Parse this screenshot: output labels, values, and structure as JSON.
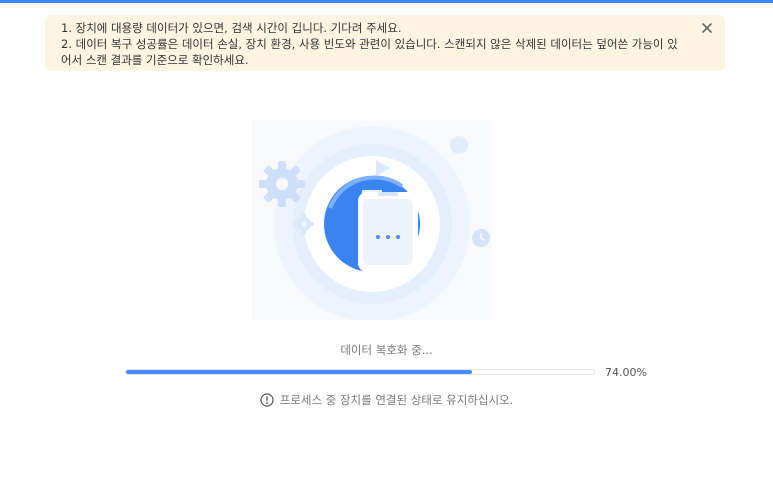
{
  "notice": {
    "lines": [
      "1. 장치에 대용량 데이터가 있으면, 검색 시간이 깁니다. 기다려 주세요.",
      "2. 데이터 복구 성공률은 데이터 손실, 장치 환경, 사용 빈도와 관련이 있습니다. 스캔되지 않은 삭제된 데이터는 덮어쓴 가능이 있어서 스캔 결과를 기준으로 확인하세요."
    ],
    "close_icon": "close-icon"
  },
  "status": {
    "label": "데이터 복호화 중...",
    "progress_percent": 74.0,
    "progress_text": "74.00%"
  },
  "warning": {
    "icon": "exclamation-circle-icon",
    "text": "프로세스 중 장치를 연결된 상태로 유지하십시오."
  },
  "colors": {
    "accent": "#3f86f5",
    "notice_bg": "#fdf4e2",
    "progress_fill": "#4a8cf6"
  }
}
